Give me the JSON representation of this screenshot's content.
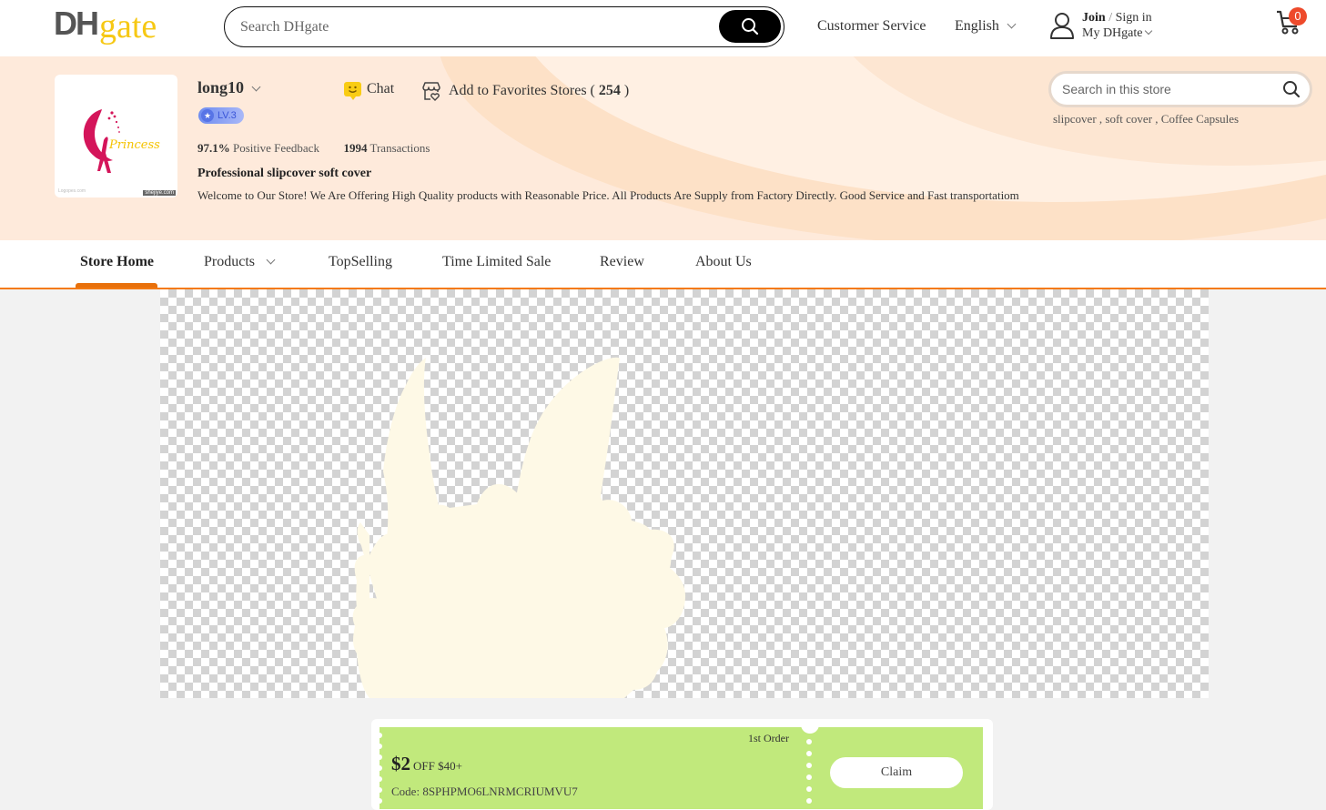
{
  "header": {
    "logo": {
      "dh": "DH",
      "gate": "gate"
    },
    "search": {
      "placeholder": "Search DHgate",
      "value": ""
    },
    "customer_service": "Custormer Service",
    "language": "English",
    "account": {
      "join": "Join",
      "separator": "/",
      "sign_in": "Sign in",
      "my_dhgate": "My DHgate"
    },
    "cart": {
      "count": "0"
    }
  },
  "store": {
    "logo_text": "Princess",
    "logo_watermark_left": "Logopes.com",
    "logo_watermark_right": "shejiye.com",
    "name": "long10",
    "level": "LV.3",
    "chat_label": "Chat",
    "favorites": {
      "label": "Add to Favorites Stores (",
      "count": "254",
      "close": ")"
    },
    "positive_feedback": {
      "value": "97.1%",
      "label": "Positive Feedback"
    },
    "transactions": {
      "value": "1994",
      "label": "Transactions"
    },
    "slogan": "Professional slipcover soft cover",
    "welcome": "Welcome to Our Store! We Are Offering High Quality products with Reasonable Price. All Products Are Supply from Factory Directly. Good Service and Fast transportatiom",
    "search": {
      "placeholder": "Search in this store",
      "value": ""
    },
    "hot_words": [
      "slipcover",
      "soft cover",
      "Coffee Capsules"
    ],
    "hot_word_separator": " , "
  },
  "nav": {
    "items": [
      {
        "label": "Store Home",
        "active": true
      },
      {
        "label": "Products",
        "dropdown": true
      },
      {
        "label": "TopSelling"
      },
      {
        "label": "Time Limited Sale"
      },
      {
        "label": "Review"
      },
      {
        "label": "About Us"
      }
    ]
  },
  "banner": {
    "shape_color": "#fef9e6"
  },
  "coupon": {
    "tag": "1st Order",
    "amount": "$2",
    "condition": "OFF $40+",
    "code_label": "Code:",
    "code": "8SPHPMO6LNRMCRIUMVU7",
    "claim_label": "Claim",
    "color": "#c1e97c"
  },
  "colors": {
    "accent_orange": "#f47a12",
    "store_bg": "#feeadb",
    "logo_yellow": "#f6c814",
    "cart_badge": "#ee4a2b"
  }
}
